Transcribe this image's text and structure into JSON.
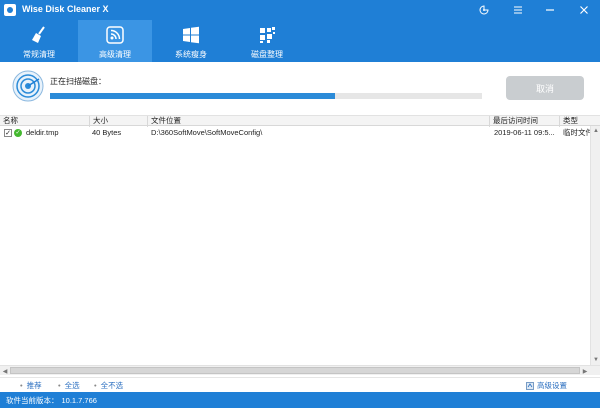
{
  "app": {
    "title": "Wise Disk Cleaner X"
  },
  "toolbar": {
    "tabs": [
      {
        "label": "常规清理",
        "icon": "broom-icon",
        "active": false
      },
      {
        "label": "高级清理",
        "icon": "signal-icon",
        "active": true
      },
      {
        "label": "系统瘦身",
        "icon": "windows-icon",
        "active": false
      },
      {
        "label": "磁盘整理",
        "icon": "blocks-icon",
        "active": false
      }
    ]
  },
  "scan": {
    "status_label": "正在扫描磁盘：",
    "progress_percent": 0.66,
    "cancel_label": "取消"
  },
  "table": {
    "columns": [
      "名称",
      "大小",
      "文件位置",
      "最后访问时间",
      "类型"
    ],
    "rows": [
      {
        "name": "deldir.tmp",
        "size": "40 Bytes",
        "location": "D:\\360SoftMove\\SoftMoveConfig\\",
        "last_access": "2019-06-11 09:5...",
        "type": "临时文件",
        "checked": true
      }
    ]
  },
  "bottom": {
    "recommend": "推荐",
    "select_all": "全选",
    "select_none": "全不选",
    "advanced_settings": "高级设置"
  },
  "status": {
    "version_label": "软件当前版本：",
    "version": "10.1.7.766"
  },
  "colors": {
    "brand_blue": "#1f7fd6",
    "tab_active": "#3b95e4",
    "progress": "#2b8bd8",
    "cancel_disabled": "#c9cdd0"
  }
}
